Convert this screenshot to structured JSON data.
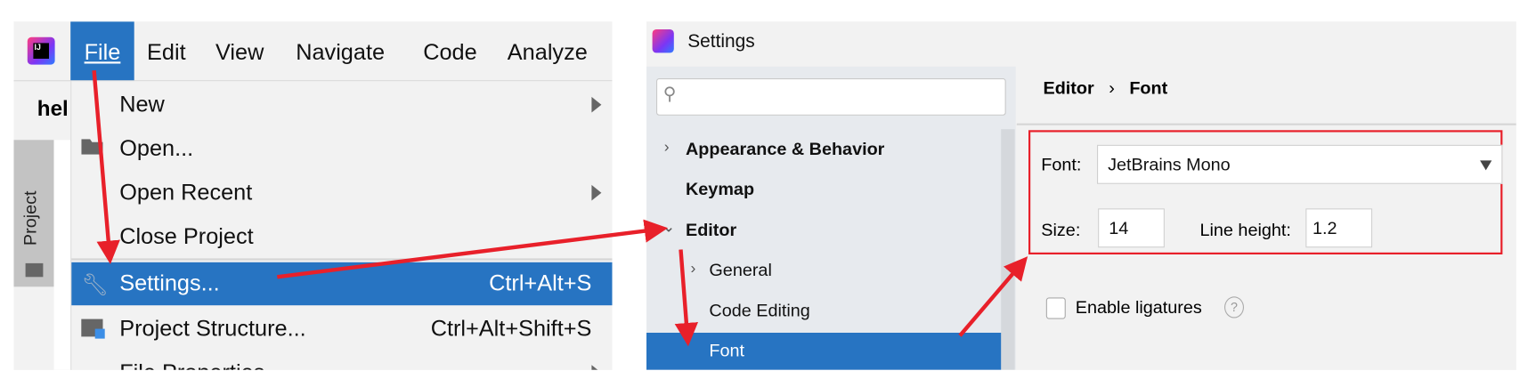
{
  "ide": {
    "logo_text": "IJ",
    "menubar": [
      "File",
      "Edit",
      "View",
      "Navigate",
      "Code",
      "Analyze"
    ],
    "editor_tab_partial": "hel",
    "tool_window": "Project",
    "file_menu": [
      {
        "label": "New",
        "submenu": true
      },
      {
        "label": "Open...",
        "icon": "folder-open-icon"
      },
      {
        "label": "Open Recent",
        "submenu": true
      },
      {
        "label": "Close Project"
      },
      {
        "label": "Settings...",
        "shortcut": "Ctrl+Alt+S",
        "icon": "wrench-icon",
        "selected": true
      },
      {
        "label": "Project Structure...",
        "shortcut": "Ctrl+Alt+Shift+S",
        "icon": "project-structure-icon"
      },
      {
        "label": "File Properties",
        "submenu": true
      }
    ]
  },
  "settings": {
    "title": "Settings",
    "search": {
      "value": "",
      "placeholder": ""
    },
    "tree": [
      {
        "label": "Appearance & Behavior",
        "expanded": false
      },
      {
        "label": "Keymap"
      },
      {
        "label": "Editor",
        "expanded": true
      },
      {
        "label": "General",
        "expanded": false
      },
      {
        "label": "Code Editing"
      },
      {
        "label": "Font",
        "selected": true
      }
    ],
    "breadcrumb": [
      "Editor",
      "Font"
    ],
    "font_label": "Font:",
    "font_value": "JetBrains Mono",
    "size_label": "Size:",
    "size_value": "14",
    "line_height_label": "Line height:",
    "line_height_value": "1.2",
    "ligatures_label": "Enable ligatures",
    "ligatures_checked": false
  },
  "colors": {
    "accent": "#2774c2",
    "annotation": "#e8202a"
  }
}
